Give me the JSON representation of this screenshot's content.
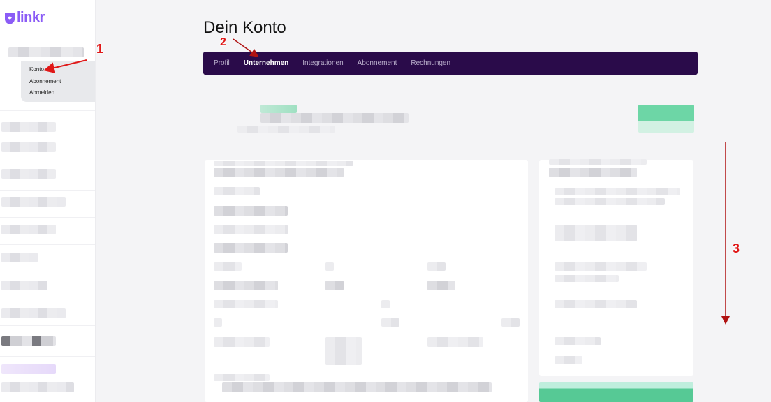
{
  "app": {
    "logo_text": "linkr",
    "brand_color": "#8b5cf6"
  },
  "sidebar": {
    "account_menu": [
      {
        "label": "Konto"
      },
      {
        "label": "Abonnement"
      },
      {
        "label": "Abmelden"
      }
    ]
  },
  "page": {
    "title": "Dein Konto"
  },
  "tabs": [
    {
      "label": "Profil",
      "active": false
    },
    {
      "label": "Unternehmen",
      "active": true
    },
    {
      "label": "Integrationen",
      "active": false
    },
    {
      "label": "Abonnement",
      "active": false
    },
    {
      "label": "Rechnungen",
      "active": false
    }
  ],
  "annotations": {
    "step1": "1",
    "step2": "2",
    "step3": "3"
  },
  "colors": {
    "tabbar": "#2a0b4a",
    "accent_green": "#56c995",
    "annotation_red": "#e01818"
  }
}
